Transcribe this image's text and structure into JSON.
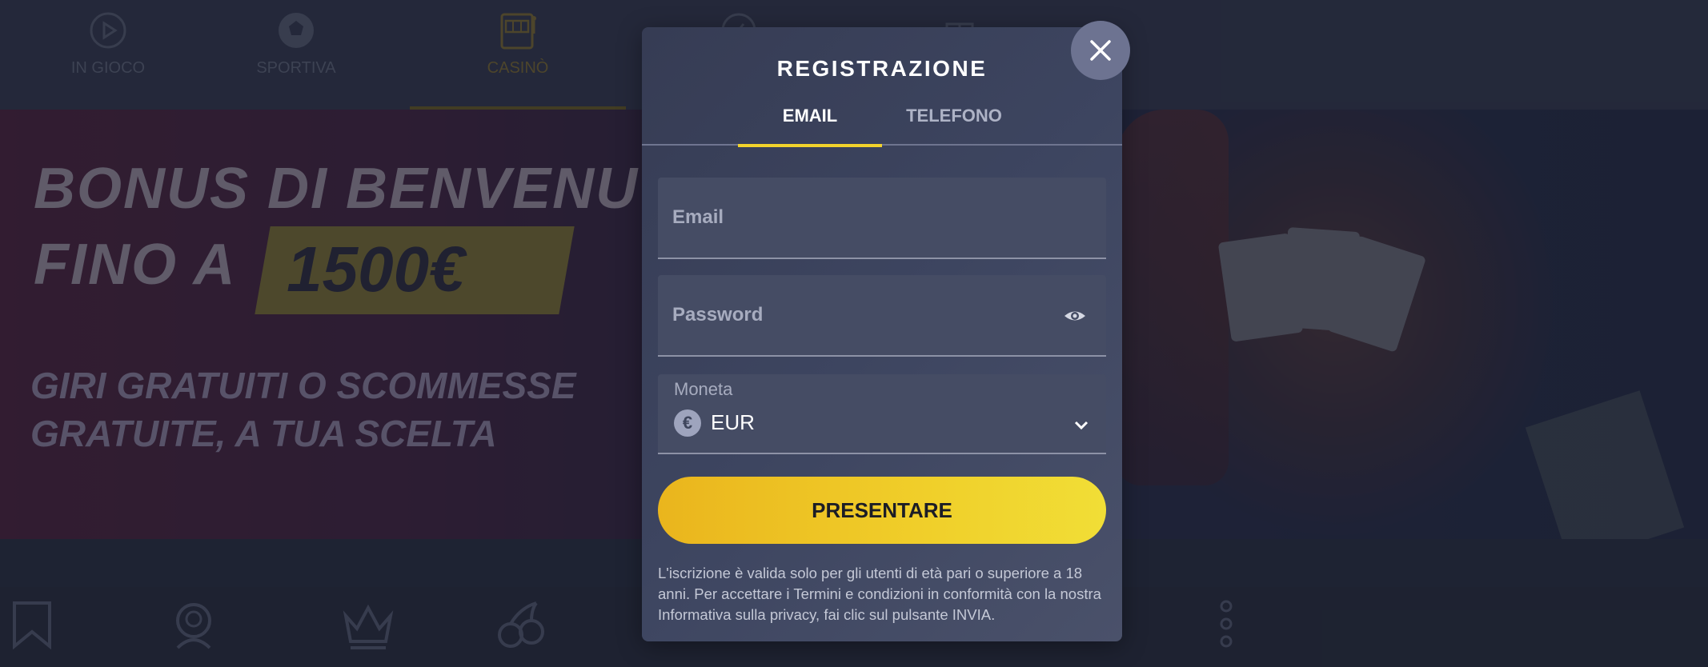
{
  "nav": {
    "items": [
      {
        "label": "IN GIOCO",
        "icon": "play-icon",
        "active": false
      },
      {
        "label": "SPORTIVA",
        "icon": "soccer-ball-icon",
        "active": false
      },
      {
        "label": "CASINÒ",
        "icon": "slot-machine-icon",
        "active": true
      },
      {
        "label": "",
        "icon": "compass-icon",
        "active": false
      },
      {
        "label": "",
        "icon": "gift-icon",
        "active": false
      }
    ]
  },
  "banner": {
    "headline_line1": "BONUS DI BENVENUTO",
    "headline_line2_prefix": "FINO A",
    "amount": "1500€",
    "sub_line1": "GIRI GRATUITI O SCOMMESSE",
    "sub_line2": "GRATUITE, A TUA SCELTA"
  },
  "bottom_nav": {
    "icons": [
      "bookmark-icon",
      "dealer-icon",
      "crown-icon",
      "cherries-icon",
      "more-vertical-icon"
    ]
  },
  "modal": {
    "title": "REGISTRAZIONE",
    "tabs": [
      {
        "label": "EMAIL",
        "active": true
      },
      {
        "label": "TELEFONO",
        "active": false
      }
    ],
    "email_placeholder": "Email",
    "email_value": "",
    "password_placeholder": "Password",
    "password_value": "",
    "currency_label": "Moneta",
    "currency_symbol": "€",
    "currency_value": "EUR",
    "submit_label": "PRESENTARE",
    "legal_text": "L'iscrizione è valida solo per gli utenti di età pari o superiore a 18 anni. Per accettare i Termini e condizioni in conformità con la nostra Informativa sulla privacy, fai clic sul pulsante INVIA."
  },
  "colors": {
    "accent": "#f2d32c",
    "modal_bg": "#3d4560",
    "page_bg": "#262b3c",
    "close_button": "#6d7391"
  }
}
